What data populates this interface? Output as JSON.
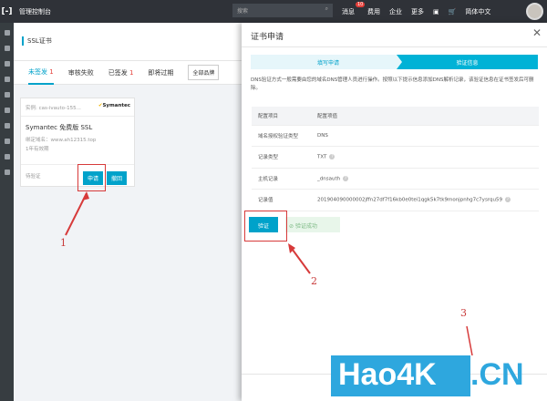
{
  "topbar": {
    "brand": "管理控制台",
    "search_placeholder": "搜索",
    "nav": [
      "消息",
      "费用",
      "企业",
      "更多",
      "简体中文"
    ],
    "badge": "10"
  },
  "page": {
    "title": "SSL证书",
    "tabs": [
      {
        "label": "未签发",
        "count": "1"
      },
      {
        "label": "审核失败",
        "count": ""
      },
      {
        "label": "已签发",
        "count": "1"
      },
      {
        "label": "即将过期",
        "count": ""
      }
    ],
    "brand_filter": "全部品牌"
  },
  "card": {
    "instance": "实例: cas-ivauto-155...",
    "vendor": "Symantec",
    "title": "Symantec 免费版 SSL",
    "domain": "绑定域名：www.ah12315.top",
    "validity": "1年有效期",
    "status": "待验证",
    "apply": "申请",
    "withdraw": "撤回"
  },
  "panel": {
    "title": "证书申请",
    "steps": [
      "填写申请",
      "验证信息"
    ],
    "description": "DNS验证方式一般需要由您的域名DNS管理人员进行操作。按照以下提示信息添加DNS解析记录，该验证信息在证书签发后可删除。",
    "headers": [
      "配置项目",
      "配置项值"
    ],
    "rows": [
      {
        "k": "域名授权验证类型",
        "v": "DNS",
        "help": false
      },
      {
        "k": "记录类型",
        "v": "TXT",
        "help": true
      },
      {
        "k": "主机记录",
        "v": "_dnsauth",
        "help": true
      },
      {
        "k": "记录值",
        "v": "201904090000002jffn27df7f16kb0e0tei1qgk5k7tk9monjpnhg7c7ysrqu59",
        "help": true
      }
    ],
    "verify": "验证",
    "success": "验证成功"
  },
  "annotations": [
    "1",
    "2",
    "3"
  ],
  "watermark": {
    "main": "Hao4K",
    "suffix": ".CN"
  }
}
